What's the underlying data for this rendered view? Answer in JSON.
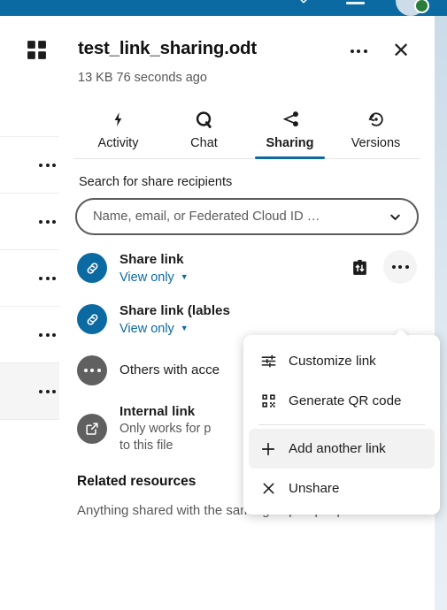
{
  "app_header": {
    "chevron_icon": "chevron-down-icon",
    "minimize_icon": "window-minimize-icon",
    "avatar_icon": "user-avatar",
    "status_icon": "online-status-dot",
    "accent_blue": "#0b6aa2"
  },
  "file_list": {
    "rows": [
      {
        "menu_label": "file-actions-1",
        "active": false
      },
      {
        "menu_label": "file-actions-2",
        "active": false
      },
      {
        "menu_label": "file-actions-3",
        "active": false
      },
      {
        "menu_label": "file-actions-4",
        "active": false
      },
      {
        "menu_label": "file-actions-5",
        "active": true
      }
    ],
    "grid_icon": "apps-grid-icon"
  },
  "sidebar": {
    "title": "test_link_sharing.odt",
    "subtitle": "13 KB 76 seconds ago",
    "actions": {
      "more_label": "•••",
      "close_label": "×"
    },
    "tabs": [
      {
        "label": "Activity",
        "icon": "lightning-bolt-icon",
        "active": false
      },
      {
        "label": "Chat",
        "icon": "chat-bubble-icon",
        "active": false
      },
      {
        "label": "Sharing",
        "icon": "share-nodes-icon",
        "active": true
      },
      {
        "label": "Versions",
        "icon": "history-restore-icon",
        "active": false
      }
    ],
    "search": {
      "label": "Search for share recipients",
      "placeholder": "Name, email, or Federated Cloud ID …",
      "value": "",
      "chevron_icon": "chevron-down-icon"
    },
    "shares": [
      {
        "title": "Share link",
        "permission": "View only",
        "icon": "link-icon",
        "avatar_color": "blue",
        "copy_icon": "copy-link-icon",
        "menu_icon": "three-dots-icon"
      },
      {
        "title": "Share link (lables",
        "permission": "View only",
        "icon": "link-icon",
        "avatar_color": "blue"
      }
    ],
    "others_with_access": {
      "title": "Others with acce",
      "icon": "three-dots-icon",
      "avatar_color": "grey"
    },
    "internal_link": {
      "title": "Internal link",
      "description_line1": "Only works for p",
      "description_line2": "to this file",
      "icon": "external-link-icon",
      "avatar_color": "grey"
    },
    "related": {
      "title": "Related resources",
      "description": "Anything shared with the same group of people"
    }
  },
  "popup_menu": {
    "items": [
      {
        "label": "Customize link",
        "icon": "sliders-icon",
        "hover": false,
        "separator_after": false
      },
      {
        "label": "Generate QR code",
        "icon": "qr-code-icon",
        "hover": false,
        "separator_after": true
      },
      {
        "label": "Add another link",
        "icon": "plus-icon",
        "hover": true,
        "separator_after": false
      },
      {
        "label": "Unshare",
        "icon": "close-x-icon",
        "hover": false,
        "separator_after": false
      }
    ]
  }
}
